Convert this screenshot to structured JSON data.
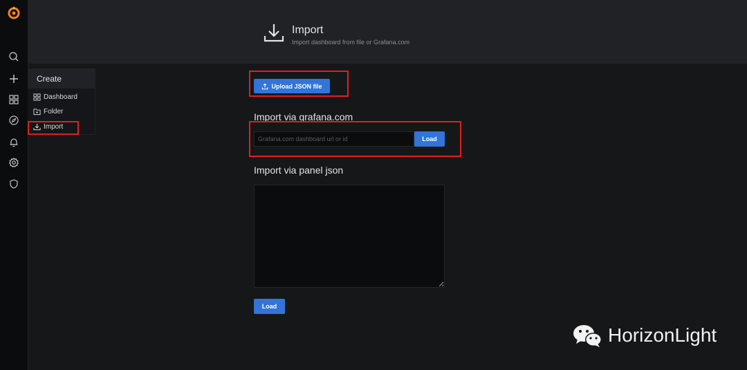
{
  "header": {
    "title": "Import",
    "subtitle": "Import dashboard from file or Grafana.com",
    "icon": "import-icon"
  },
  "sidebar": {
    "icons": [
      "grafana-logo-icon",
      "search-icon",
      "plus-icon",
      "dashboards-icon",
      "explore-icon",
      "alerting-bell-icon",
      "settings-gear-icon",
      "shield-icon"
    ]
  },
  "create_menu": {
    "title": "Create",
    "items": [
      {
        "label": "Dashboard",
        "icon": "dashboards-icon"
      },
      {
        "label": "Folder",
        "icon": "folder-icon"
      },
      {
        "label": "Import",
        "icon": "import-icon"
      }
    ]
  },
  "main": {
    "upload_button": "Upload JSON file",
    "via_grafana_title": "Import via grafana.com",
    "grafana_input_placeholder": "Grafana.com dashboard url or id",
    "grafana_load_button": "Load",
    "via_panel_title": "Import via panel json",
    "panel_load_button": "Load"
  },
  "watermark": {
    "text": "HorizonLight",
    "icon": "wechat-icon"
  },
  "colors": {
    "accent": "#3274d9",
    "highlight": "#e02020",
    "logo": "#f5821f"
  }
}
